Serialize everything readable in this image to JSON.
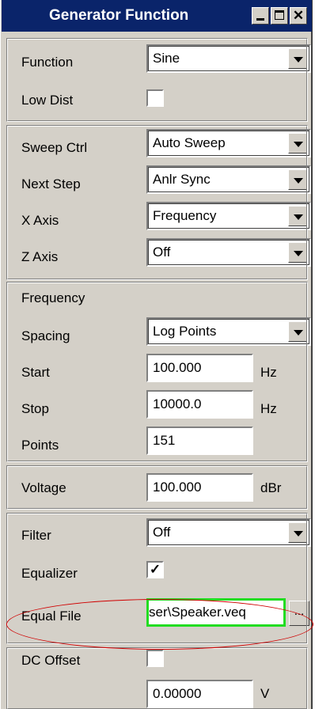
{
  "window": {
    "title": "Generator Function"
  },
  "titlebar_buttons": [
    "minimize",
    "maximize",
    "close"
  ],
  "group1": {
    "function": {
      "label": "Function",
      "value": "Sine"
    },
    "low_dist": {
      "label": "Low Dist",
      "checked": false
    }
  },
  "group2": {
    "sweep_ctrl": {
      "label": "Sweep Ctrl",
      "value": "Auto Sweep"
    },
    "next_step": {
      "label": "Next Step",
      "value": "Anlr Sync"
    },
    "x_axis": {
      "label": "X Axis",
      "value": "Frequency"
    },
    "z_axis": {
      "label": "Z Axis",
      "value": "Off"
    }
  },
  "group3": {
    "heading": "Frequency",
    "spacing": {
      "label": "Spacing",
      "value": "Log Points"
    },
    "start": {
      "label": "Start",
      "value": "100.000",
      "unit": "Hz"
    },
    "stop": {
      "label": "Stop",
      "value": "10000.0",
      "unit": "Hz"
    },
    "points": {
      "label": "Points",
      "value": "151"
    }
  },
  "group4": {
    "voltage": {
      "label": "Voltage",
      "value": "100.000",
      "unit": "dBr"
    }
  },
  "group5": {
    "filter": {
      "label": "Filter",
      "value": "Off"
    },
    "equalizer": {
      "label": "Equalizer",
      "check_mark": "✓"
    },
    "equal_file": {
      "label": "Equal File",
      "value": "ser\\Speaker.veq",
      "browse_label": "..."
    }
  },
  "group6": {
    "dc_offset": {
      "label": "DC Offset",
      "checked": false
    },
    "offset_value": {
      "value": "0.00000",
      "unit": "V"
    }
  },
  "colors": {
    "titlebar": "#0a246a",
    "panel": "#d4d0c8",
    "highlight_ellipse": "#d00000",
    "focus_border": "#22dd22"
  }
}
